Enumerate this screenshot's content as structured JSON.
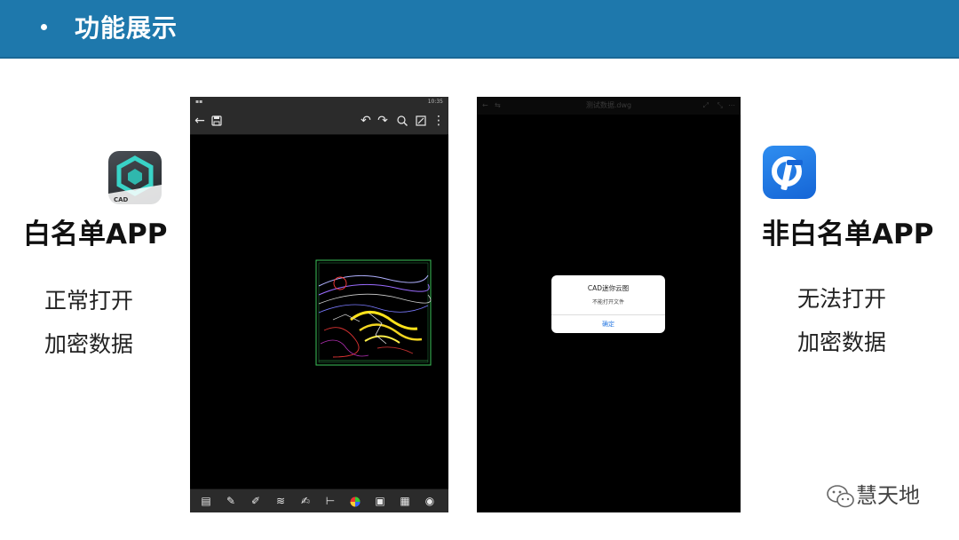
{
  "header": {
    "title": "功能展示"
  },
  "left": {
    "app_icon": "cad-viewer-app-icon",
    "app_icon_text": "CAD",
    "label": "白名单APP",
    "line1": "正常打开",
    "line2": "加密数据"
  },
  "right": {
    "app_icon": "blue-ip-app-icon",
    "label": "非白名单APP",
    "line1": "无法打开",
    "line2": "加密数据"
  },
  "phone1": {
    "status_time": "10:35",
    "toolbar_icons": [
      "back-arrow-icon",
      "save-icon",
      "undo-icon",
      "redo-icon",
      "zoom-icon",
      "fullscreen-icon",
      "more-vert-icon"
    ],
    "bottom_icons": [
      "comment-icon",
      "markup-icon",
      "edit-icon",
      "layers-icon",
      "sign-icon",
      "measure-icon",
      "color-wheel-icon",
      "toolbox-icon",
      "grid-icon",
      "eye-icon"
    ]
  },
  "phone2": {
    "file_title": "测试数据.dwg",
    "dialog": {
      "title": "CAD迷你云图",
      "message": "不能打开文件",
      "button": "确定"
    }
  },
  "watermark": {
    "text": "慧天地"
  },
  "colors": {
    "header_bg": "#1e78ac",
    "dialog_button": "#2a7ae2"
  }
}
